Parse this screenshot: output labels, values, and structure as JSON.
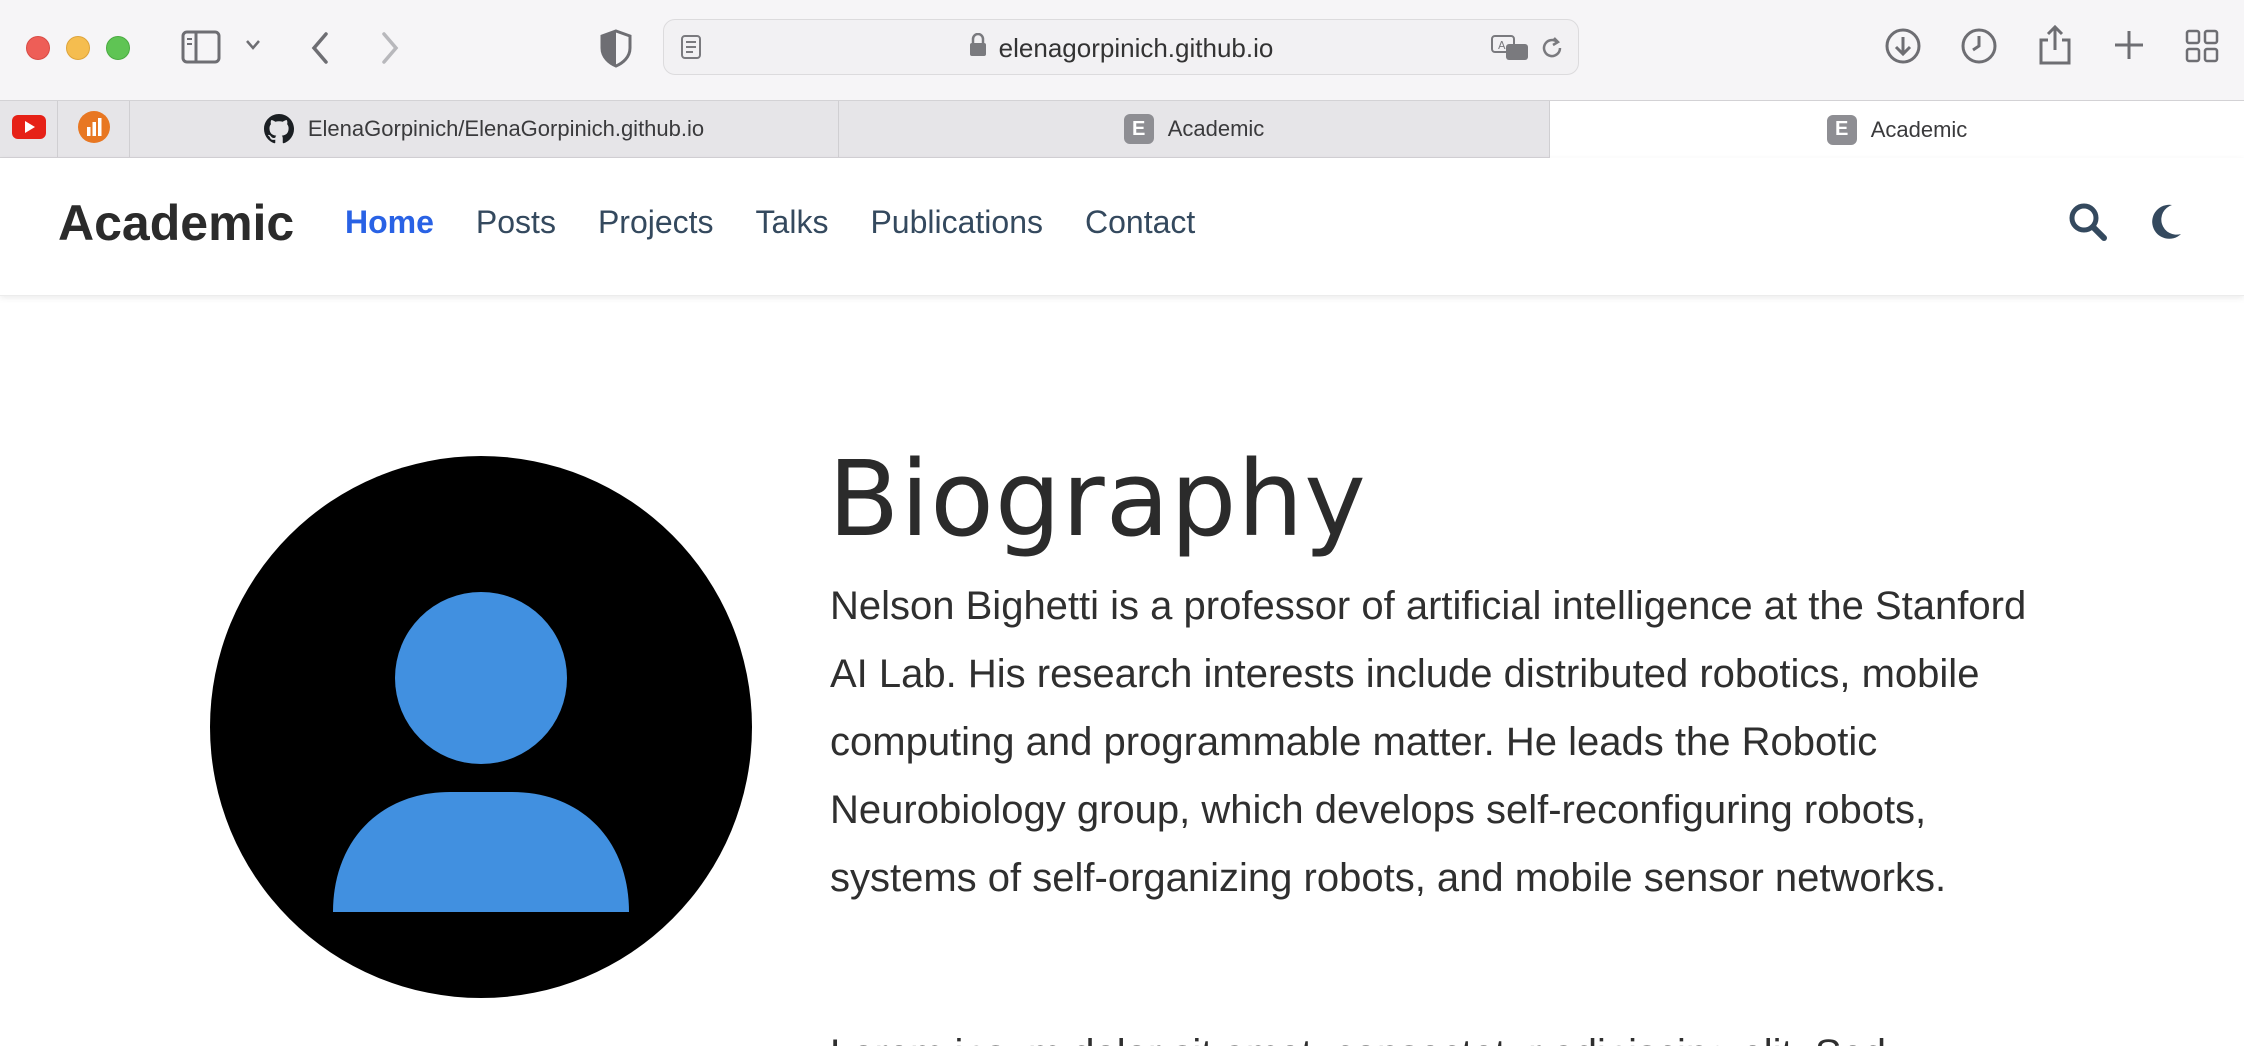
{
  "browser": {
    "url": "elenagorpinich.github.io",
    "tabs": [
      {
        "label": "ElenaGorpinich/ElenaGorpinich.github.io",
        "favicon": "github-icon",
        "active": false
      },
      {
        "label": "Academic",
        "favicon": "E",
        "active": false
      },
      {
        "label": "Academic",
        "favicon": "E",
        "active": true
      }
    ],
    "pinned_tabs": [
      "youtube-icon",
      "analytics-icon"
    ],
    "colors": {
      "toolbar": "#f6f5f7",
      "tabbar": "#e6e5e8"
    }
  },
  "site": {
    "brand": "Academic",
    "nav": [
      {
        "label": "Home",
        "active": true
      },
      {
        "label": "Posts",
        "active": false
      },
      {
        "label": "Projects",
        "active": false
      },
      {
        "label": "Talks",
        "active": false
      },
      {
        "label": "Publications",
        "active": false
      },
      {
        "label": "Contact",
        "active": false
      }
    ],
    "accent_color": "#1565c0"
  },
  "bio": {
    "title": "Biography",
    "paragraph": "Nelson Bighetti is a professor of artificial intelligence at the Stanford AI Lab. His research interests include distributed robotics, mobile computing and programmable matter. He leads the Robotic Neurobiology group, which develops self-reconfiguring robots, systems of self-organizing robots, and mobile sensor networks.",
    "paragraph_2_partial": "Lorem ipsum dolor sit amet, consectetur adipiscing elit. Sed",
    "avatar": {
      "icon": "user-avatar-icon",
      "background": "#000000",
      "figure_color": "#4190e0"
    }
  }
}
